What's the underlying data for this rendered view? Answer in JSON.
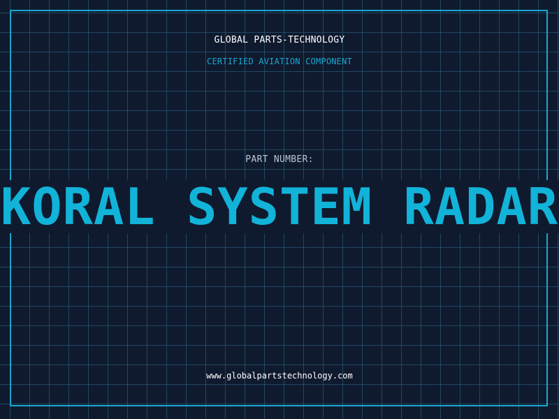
{
  "header": {
    "company_name": "GLOBAL PARTS-TECHNOLOGY",
    "tagline": "CERTIFIED AVIATION COMPONENT"
  },
  "part": {
    "label": "PART NUMBER:",
    "value": "KORAL SYSTEM RADAR"
  },
  "footer": {
    "website": "www.globalpartstechnology.com"
  },
  "colors": {
    "background": "#101a2e",
    "accent": "#12b3d8",
    "frame": "#1aa7cf",
    "grid": "#266e8c",
    "label": "#b9c4d2",
    "text": "#ffffff"
  }
}
